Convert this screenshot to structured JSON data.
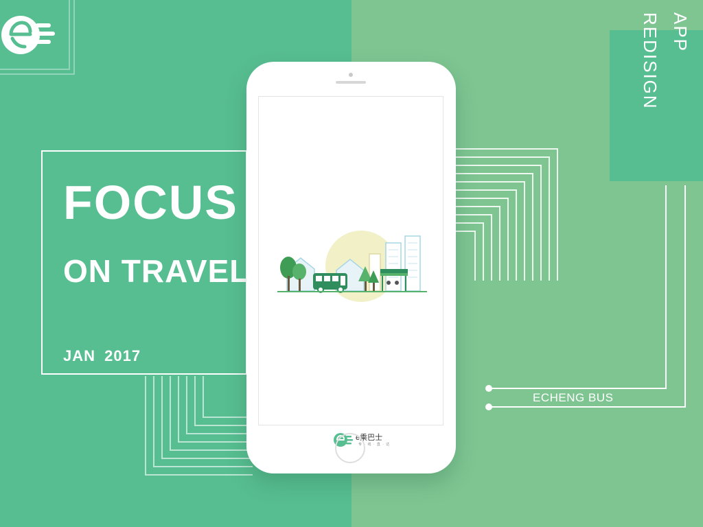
{
  "hero": {
    "title_line1": "FOCUS",
    "title_line2": "ON TRAVEL",
    "date": "JAN 2017"
  },
  "side_badge": {
    "line1": "APP",
    "line2": "REDISIGN"
  },
  "brand": {
    "label": "ECHENG BUS"
  },
  "app_splash": {
    "name": "e乘巴士",
    "slogan": "专 · 线 · 直 · 达"
  },
  "colors": {
    "primary_green": "#57be91",
    "secondary_green": "#7ec592",
    "white": "#ffffff"
  },
  "icons": [
    "bus-logo-icon",
    "city-illustration"
  ]
}
